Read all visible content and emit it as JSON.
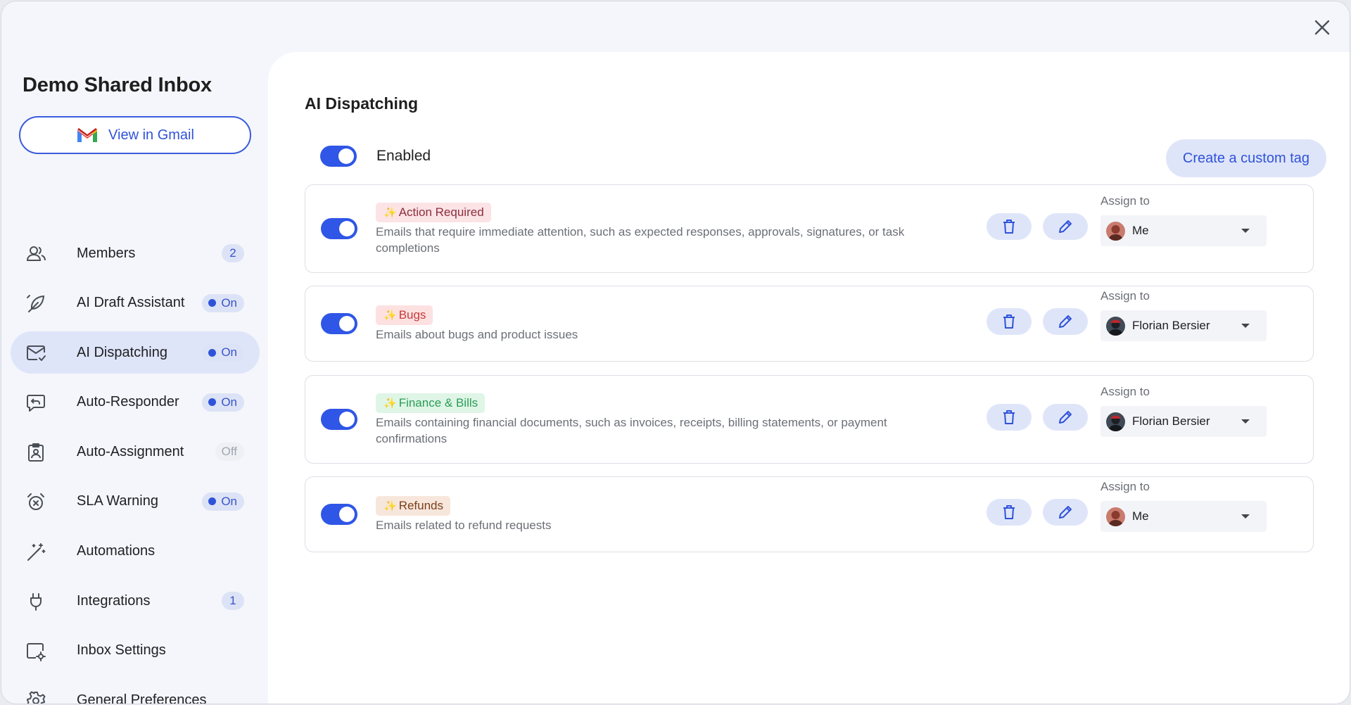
{
  "sidebar": {
    "inbox_title": "Demo Shared Inbox",
    "gmail_button_label": "View in Gmail",
    "items": [
      {
        "label": "Members",
        "icon": "members-icon",
        "badge": "2"
      },
      {
        "label": "AI Draft Assistant",
        "icon": "feather-pen-icon",
        "status": "On"
      },
      {
        "label": "AI Dispatching",
        "icon": "mail-dispatch-icon",
        "status": "On",
        "active": true
      },
      {
        "label": "Auto-Responder",
        "icon": "reply-bubble-icon",
        "status": "On"
      },
      {
        "label": "Auto-Assignment",
        "icon": "assignment-badge-icon",
        "status": "Off"
      },
      {
        "label": "SLA Warning",
        "icon": "alarm-clock-icon",
        "status": "On"
      },
      {
        "label": "Automations",
        "icon": "magic-wand-icon"
      },
      {
        "label": "Integrations",
        "icon": "plug-icon",
        "badge": "1"
      },
      {
        "label": "Inbox Settings",
        "icon": "inbox-settings-icon"
      },
      {
        "label": "General Preferences",
        "icon": "gear-icon"
      }
    ]
  },
  "main": {
    "title": "AI Dispatching",
    "enabled_label": "Enabled",
    "create_tag_label": "Create a custom tag",
    "assign_label": "Assign to",
    "rules": [
      {
        "tag": "Action Required",
        "tag_bg": "#fbe3e6",
        "tag_color": "#8c2f3c",
        "description": "Emails that require immediate attention, such as expected responses, approvals, signatures, or task completions",
        "assignee": "Me"
      },
      {
        "tag": "Bugs",
        "tag_bg": "#fde1e1",
        "tag_color": "#c63b3b",
        "description": "Emails about bugs and product issues",
        "assignee": "Florian Bersier"
      },
      {
        "tag": "Finance & Bills",
        "tag_bg": "#dff5e6",
        "tag_color": "#2a9d57",
        "description": "Emails containing financial documents, such as invoices, receipts, billing statements, or payment confirmations",
        "assignee": "Florian Bersier"
      },
      {
        "tag": "Refunds",
        "tag_bg": "#f7e6dc",
        "tag_color": "#7a3f19",
        "description": "Emails related to refund requests",
        "assignee": "Me"
      }
    ]
  },
  "colors": {
    "accent": "#2f53d8",
    "toggle_on": "#2f56e6",
    "pill_bg": "#dfe5f9"
  }
}
